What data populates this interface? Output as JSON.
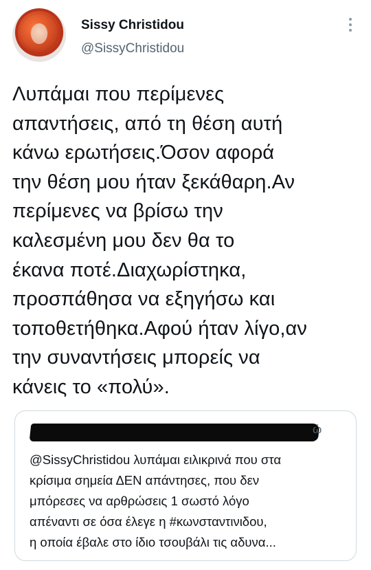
{
  "author": {
    "name": "Sissy Christidou",
    "handle": "@SissyChristidou"
  },
  "tweet": {
    "lines": [
      "Λυπάμαι που περίμενες",
      "απαντήσεις, από τη θέση αυτή",
      "κάνω ερωτήσεις.Όσον αφορά",
      "την θέση μου ήταν ξεκάθαρη.Αν",
      "περίμενες να βρίσω την",
      "καλεσμένη μου δεν θα το",
      "έκανα ποτέ.Διαχωρίστηκα,",
      "προσπάθησα να εξηγήσω και",
      "τοποθετήθηκα.Αφού ήταν λίγο,αν",
      "την συναντήσεις μπορείς να",
      "κάνεις το «πολύ»."
    ]
  },
  "quoted_tweet": {
    "header_suffix": "ώ",
    "lines": [
      "@SissyChristidou λυπάμαι ειλικρινά που στα",
      "κρίσιμα σημεία ΔΕΝ απάντησες, που δεν",
      "μπόρεσες να αρθρώσεις 1 σωστό λόγο",
      "απέναντι σε όσα έλεγε η #κωνσταντινιδου,",
      "η οποία έβαλε στο ίδιο τσουβάλι τις αδυνα..."
    ]
  }
}
